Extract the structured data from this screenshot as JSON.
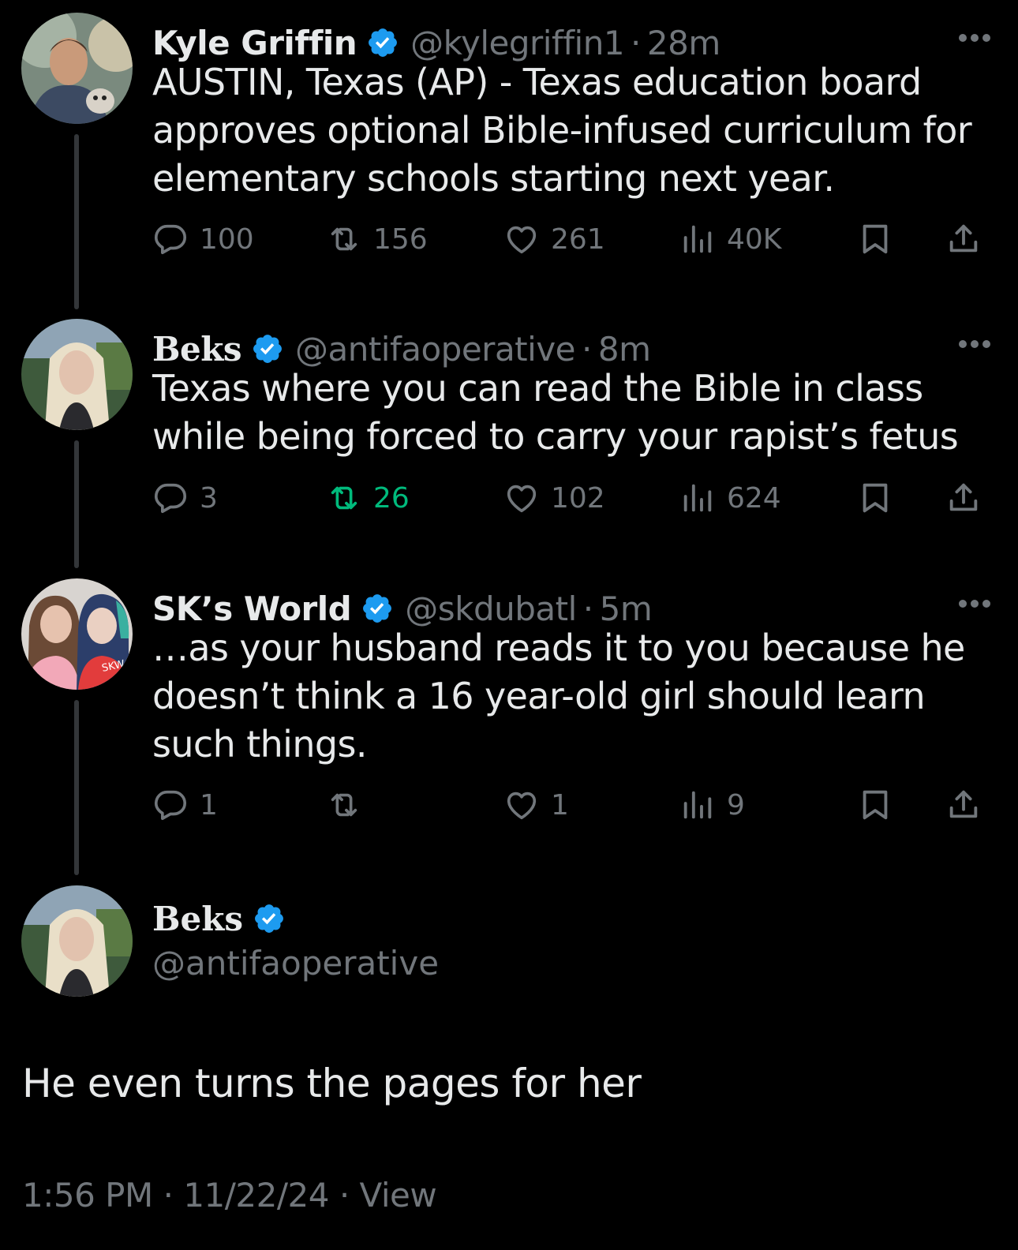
{
  "colors": {
    "background": "#000000",
    "text": "#e7e9ea",
    "muted": "#71767b",
    "verified": "#1d9bf0",
    "retweeted": "#00ba7c",
    "thread_line": "#333639"
  },
  "tweets": [
    {
      "name": "Kyle Griffin",
      "handle": "@kylegriffin1",
      "separator": "·",
      "time": "28m",
      "verified": true,
      "text": "AUSTIN, Texas (AP) - Texas education board approves optional Bible-infused curriculum for elementary schools starting next year.",
      "replies": "100",
      "reposts": "156",
      "likes": "261",
      "views": "40K",
      "reposted_by_me": false
    },
    {
      "name": "Beks",
      "handle": "@antifaoperative",
      "separator": "·",
      "time": "8m",
      "verified": true,
      "text": "Texas where you can read the Bible in class while being forced to carry your rapist’s fetus",
      "replies": "3",
      "reposts": "26",
      "likes": "102",
      "views": "624",
      "reposted_by_me": true
    },
    {
      "name": "SK’s World",
      "handle": "@skdubatl",
      "separator": "·",
      "time": "5m",
      "verified": true,
      "text": "…as your husband reads it to you because he doesn’t think a 16 year-old girl should learn such things.",
      "replies": "1",
      "reposts": "",
      "likes": "1",
      "views": "9",
      "reposted_by_me": false
    }
  ],
  "main_tweet": {
    "name": "Beks",
    "handle": "@antifaoperative",
    "verified": true,
    "text": "He even turns the pages for her",
    "time": "1:56 PM",
    "date": "11/22/24",
    "separator": "·",
    "view_link": "View"
  },
  "icons": {
    "reply": "reply-icon",
    "repost": "repost-icon",
    "like": "heart-icon",
    "views": "views-chart-icon",
    "bookmark": "bookmark-icon",
    "share": "share-icon",
    "verified": "verified-badge-icon",
    "more": "more-dots-icon"
  }
}
